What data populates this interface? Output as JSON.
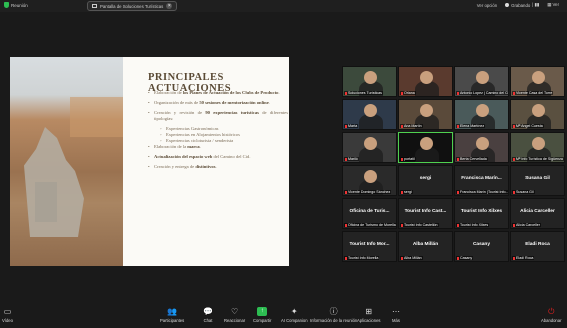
{
  "topbar": {
    "app_label": "Reunión",
    "share_label": "Pantalla de Soluciones Turísticas",
    "view_option": "Ver opción",
    "recording": "Grabando",
    "rec_controls": "| ▮▮",
    "view": "Ver",
    "gallery_glyph": "▦"
  },
  "slide": {
    "title": "PRINCIPALES ACTUACIONES",
    "bullets": [
      {
        "pre": "Elaboración de ",
        "bold": "los Planes de Actuación de los Clubs de Producto",
        "post": "."
      },
      {
        "pre": "Organización de más de ",
        "bold": "50 sesiones de mentorización online",
        "post": "."
      },
      {
        "pre": "Creación y revisión de ",
        "bold": "90 experiencias turísticas",
        "post": " de diferentes tipologías:"
      },
      {
        "pre": "",
        "bold": "",
        "post": "Experiencias Gastronómicas",
        "sub": true
      },
      {
        "pre": "",
        "bold": "",
        "post": "Experiencias en Alojamientos históricos",
        "sub": true
      },
      {
        "pre": "",
        "bold": "",
        "post": "Experiencias cicloturista / senderista",
        "sub": true
      },
      {
        "pre": "Elaboración de la ",
        "bold": "marca",
        "post": "."
      },
      {
        "pre": "",
        "bold": "Actualización del espacio web",
        "post": " del Camino del Cid."
      },
      {
        "pre": "Creación y entrega de ",
        "bold": "distintivos",
        "post": "."
      }
    ]
  },
  "participants": [
    {
      "name": "Soluciones Turísticas",
      "type": "video",
      "bg": "#3c4a3c"
    },
    {
      "name": "Oriana",
      "type": "video",
      "bg": "#5a3a2e"
    },
    {
      "name": "Antonio Lopez | Camino del Cid",
      "type": "video",
      "bg": "#4a4a4a"
    },
    {
      "name": "Vicente Casa del Torre",
      "type": "video",
      "bg": "#6a5a4a"
    },
    {
      "name": "Marta",
      "type": "video",
      "bg": "#2e3a4a"
    },
    {
      "name": "Ana Martín",
      "type": "video",
      "bg": "#5a4a3a"
    },
    {
      "name": "Elena Martínez",
      "type": "video",
      "bg": "#4a5a5a"
    },
    {
      "name": "Mª Angel Cuesta",
      "type": "video",
      "bg": "#5a5040"
    },
    {
      "name": "Mariló",
      "type": "video",
      "bg": "#3a3a3a"
    },
    {
      "name": "portatil",
      "type": "video",
      "bg": "#101010",
      "active": true
    },
    {
      "name": "Berta Cervellada",
      "type": "video",
      "bg": "#4a4040"
    },
    {
      "name": "Mª Info Turística de Sigüenza",
      "type": "video",
      "bg": "#4a5040"
    },
    {
      "name": "Vicente Domingo Sánchez",
      "type": "video",
      "bg": "#2a2a2a"
    },
    {
      "name": "sergi",
      "type": "name",
      "label": "sergi"
    },
    {
      "name": "Francisca Marín (Tourist Info...)",
      "type": "name",
      "label": "Francisca Marín..."
    },
    {
      "name": "Susana Gil",
      "type": "name",
      "label": "Susana Gil"
    },
    {
      "name": "Oficina de Turismo de Morella",
      "type": "name",
      "label": "Oficina de Turis..."
    },
    {
      "name": "Tourist Info Castellón",
      "type": "name",
      "label": "Tourist Info Cast..."
    },
    {
      "name": "Tourist Info Xilxes",
      "type": "name",
      "label": "Tourist Info Xilxes"
    },
    {
      "name": "Alicia Carceller",
      "type": "name",
      "label": "Alicia Carceller"
    },
    {
      "name": "Tourist Info Morella",
      "type": "name",
      "label": "Tourist Info Mor..."
    },
    {
      "name": "Alba Millán",
      "type": "name",
      "label": "Alba Millán"
    },
    {
      "name": "Casany",
      "type": "name",
      "label": "Casany"
    },
    {
      "name": "Eladi Roca",
      "type": "name",
      "label": "Eladi Roca"
    }
  ],
  "toolbar": {
    "video": "Vídeo",
    "participants": "Participantes",
    "participants_count": "27",
    "chat": "Chat",
    "react": "Reaccionar",
    "share": "Compartir",
    "ai": "AI Companion",
    "meeting_info": "Información de la reunión",
    "apps": "Aplicaciones",
    "more": "Más",
    "end": "Abandonar"
  },
  "colors": {
    "share_green": "#2dbd52",
    "end_red": "#e02020",
    "active_border": "#4fd14f"
  }
}
